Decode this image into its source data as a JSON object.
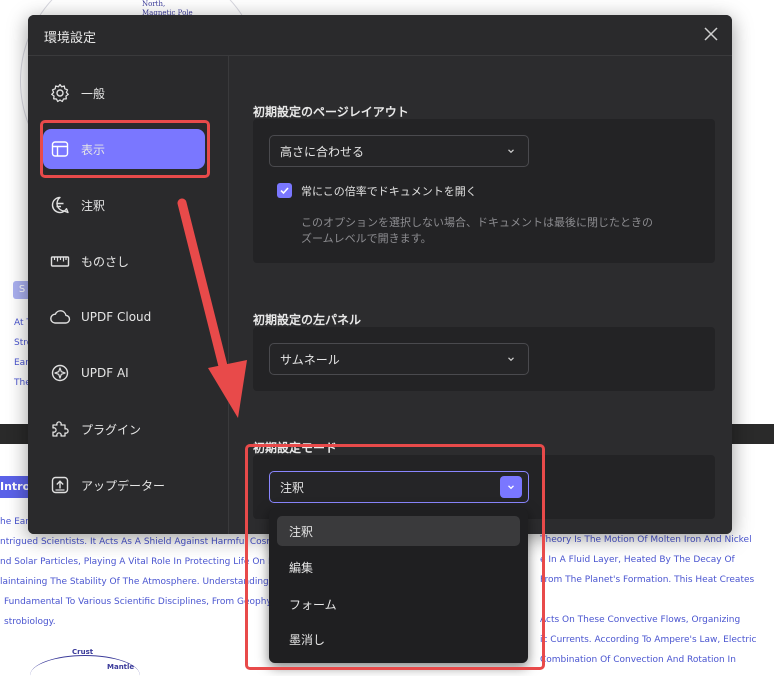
{
  "background_document": {
    "north_label": "North,\nMagnetic Pole",
    "chip_text": "S",
    "left_lines": [
      "At T",
      "Stro",
      "Eart",
      "The"
    ],
    "intro_label": "Introd",
    "left_paragraph": [
      "he Eart",
      "ntrigued Scientists. It Acts As A Shield Against Harmful Cosmic Ra",
      "nd Solar Particles, Playing A Vital Role In Protecting Life On Earth",
      "laintaining The Stability Of The Atmosphere. Understanding Its Fo",
      "Fundamental To Various Scientific Disciplines, From Geophysics",
      "strobiology."
    ],
    "right_paragraph": [
      "Theory Is The Motion Of Molten Iron And Nickel",
      "e In A Fluid Layer, Heated By The Decay Of",
      "From The Planet's Formation. This Heat Creates",
      "Acts On These Convective Flows, Organizing",
      "ic Currents. According To Ampere's Law, Electric",
      "Combination Of Convection And Rotation In"
    ],
    "diagram_labels": {
      "crust": "Crust",
      "mantle": "Mantle"
    }
  },
  "dialog": {
    "title": "環境設定",
    "sidebar": [
      {
        "label": "一般",
        "icon": "gear-icon"
      },
      {
        "label": "表示",
        "icon": "layout-icon",
        "active": true
      },
      {
        "label": "注釈",
        "icon": "annotation-icon"
      },
      {
        "label": "ものさし",
        "icon": "ruler-icon"
      },
      {
        "label": "UPDF Cloud",
        "icon": "cloud-icon"
      },
      {
        "label": "UPDF AI",
        "icon": "ai-icon"
      },
      {
        "label": "プラグイン",
        "icon": "plugin-icon"
      },
      {
        "label": "アップデーター",
        "icon": "update-icon"
      }
    ],
    "page_layout": {
      "title": "初期設定のページレイアウト",
      "selected": "高さに合わせる",
      "checkbox_label": "常にこの倍率でドキュメントを開く",
      "checkbox_checked": true,
      "hint_line1": "このオプションを選択しない場合、ドキュメントは最後に閉じたときの",
      "hint_line2": "ズームレベルで開きます。"
    },
    "left_panel": {
      "title": "初期設定の左パネル",
      "selected": "サムネール"
    },
    "mode": {
      "title": "初期設定モード",
      "selected": "注釈",
      "options": [
        "注釈",
        "編集",
        "フォーム",
        "墨消し"
      ]
    }
  },
  "colors": {
    "accent": "#7a77ff",
    "annotation_red": "#e84a4a",
    "dialog_bg": "#2a2a2c"
  }
}
